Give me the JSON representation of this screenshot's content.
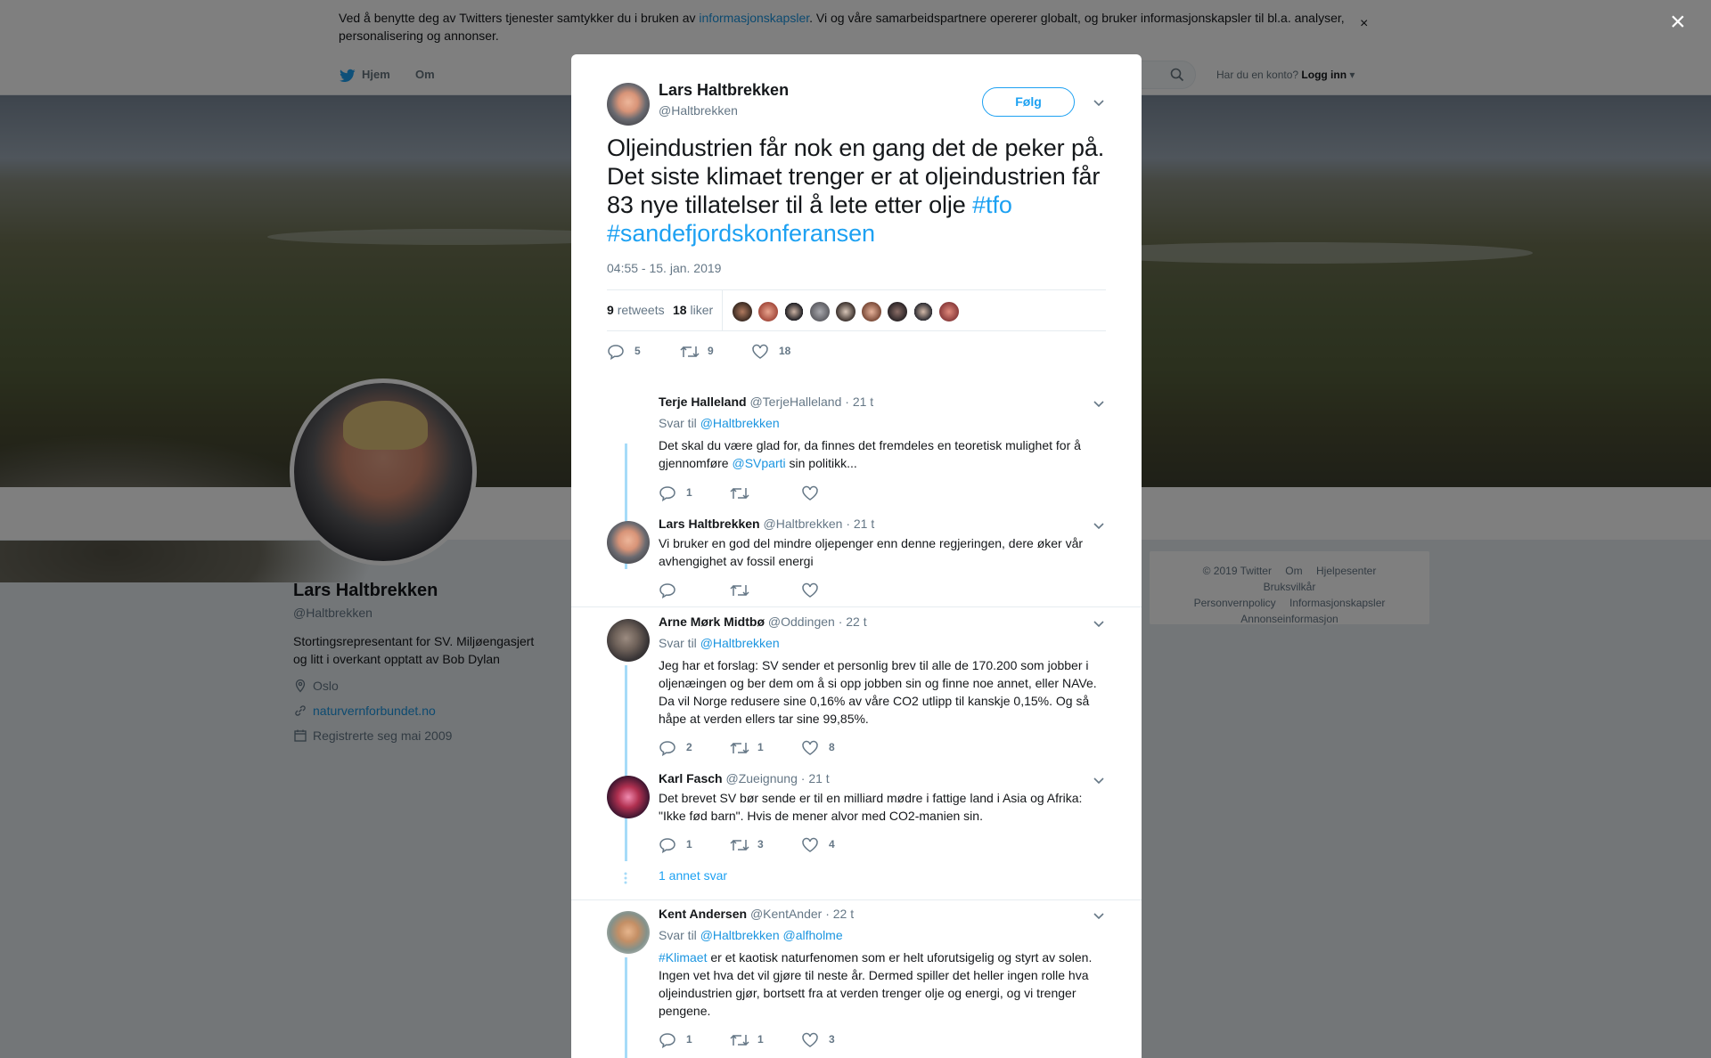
{
  "cookie": {
    "prefix": "Ved å benytte deg av Twitters tjenester samtykker du i bruken av ",
    "link": "informasjonskapsler",
    "suffix": ". Vi og våre samarbeidspartnere opererer globalt, og bruker informasjonskapsler til bl.a. analyser, personalisering og annonser.",
    "close": "×"
  },
  "nav": {
    "home": "Hjem",
    "about": "Om",
    "have_account": "Har du en konto?",
    "login": "Logg inn"
  },
  "profile": {
    "name": "Lars Haltbrekken",
    "handle": "@Haltbrekken",
    "bio": "Stortingsrepresentant for SV. Miljøengasjert og litt i overkant opptatt av Bob Dylan",
    "location": "Oslo",
    "website": "naturvernforbundet.no",
    "joined": "Registrerte seg mai 2009"
  },
  "footer": {
    "items": [
      "© 2019 Twitter",
      "Om",
      "Hjelpesenter",
      "Bruksvilkår",
      "Personvernpolicy",
      "Informasjonskapsler",
      "Annonseinformasjon"
    ]
  },
  "modal": {
    "close": "×",
    "author_name": "Lars Haltbrekken",
    "author_handle": "@Haltbrekken",
    "follow": "Følg",
    "text": "Oljeindustrien får nok en gang det de peker på. Det siste klimaet trenger er at oljeindustrien får 83 nye tillatelser til å lete etter olje ",
    "tag1": "#tfo",
    "tag2": "#sandefjordskonferansen",
    "time": "04:55 - 15. jan. 2019",
    "retweets_count": "9",
    "retweets_label": "retweets",
    "likes_count": "18",
    "likes_label": "liker",
    "actions": {
      "replies": "5",
      "retweets": "9",
      "likes": "18"
    }
  },
  "replies": [
    {
      "name": "Terje Halleland",
      "handle": "@TerjeHalleland",
      "time": "· 21 t",
      "reply_to_label": "Svar til",
      "reply_to": "@Haltbrekken",
      "text_a": "Det skal du være glad for, da finnes det fremdeles en teoretisk mulighet for å gjennomføre ",
      "mention": "@SVparti",
      "text_b": " sin politikk...",
      "replies": "1",
      "retweets": "",
      "likes": ""
    },
    {
      "name": "Lars Haltbrekken",
      "handle": "@Haltbrekken",
      "time": "· 21 t",
      "text": "Vi bruker en god del mindre oljepenger enn denne regjeringen, dere øker vår avhengighet av fossil energi",
      "replies": "",
      "retweets": "",
      "likes": ""
    },
    {
      "name": "Arne Mørk Midtbø",
      "handle": "@Oddingen",
      "time": "· 22 t",
      "reply_to_label": "Svar til",
      "reply_to": "@Haltbrekken",
      "text": "Jeg har et forslag: SV sender et personlig brev til alle de 170.200 som jobber i oljenæingen og ber dem om å si opp jobben sin og finne noe annet, eller NAVe. Da vil Norge redusere sine 0,16% av våre CO2 utlipp til kanskje 0,15%.  Og så håpe at verden ellers tar sine 99,85%.",
      "replies": "2",
      "retweets": "1",
      "likes": "8"
    },
    {
      "name": "Karl Fasch",
      "handle": "@Zueignung",
      "time": "· 21 t",
      "text": "Det brevet SV bør sende er til en milliard mødre i fattige land i Asia og Afrika: \"Ikke fød barn\". Hvis de mener alvor med CO2-manien sin.",
      "replies": "1",
      "retweets": "3",
      "likes": "4"
    },
    {
      "name": "Kent Andersen",
      "handle": "@KentAnder",
      "time": "· 22 t",
      "reply_to_label": "Svar til",
      "reply_to": "@Haltbrekken @alfholme",
      "hashtag": "#Klimaet",
      "text": " er et kaotisk naturfenomen som er helt uforutsigelig og styrt av solen. Ingen vet hva det vil gjøre til neste år. Dermed spiller det heller ingen rolle hva oljeindustrien gjør, bortsett fra at verden trenger olje og energi, og vi trenger pengene.",
      "replies": "1",
      "retweets": "1",
      "likes": "3"
    }
  ],
  "more_replies": "1 annet svar",
  "colors": {
    "accent": "#1da1f2",
    "link": "#1b95e0",
    "thread": "#a6dbf8",
    "muted": "#657786"
  },
  "icons": [
    "twitter-bird-icon",
    "search-icon",
    "close-icon",
    "chevron-down-icon",
    "reply-icon",
    "retweet-icon",
    "like-icon",
    "location-icon",
    "link-icon",
    "calendar-icon"
  ]
}
